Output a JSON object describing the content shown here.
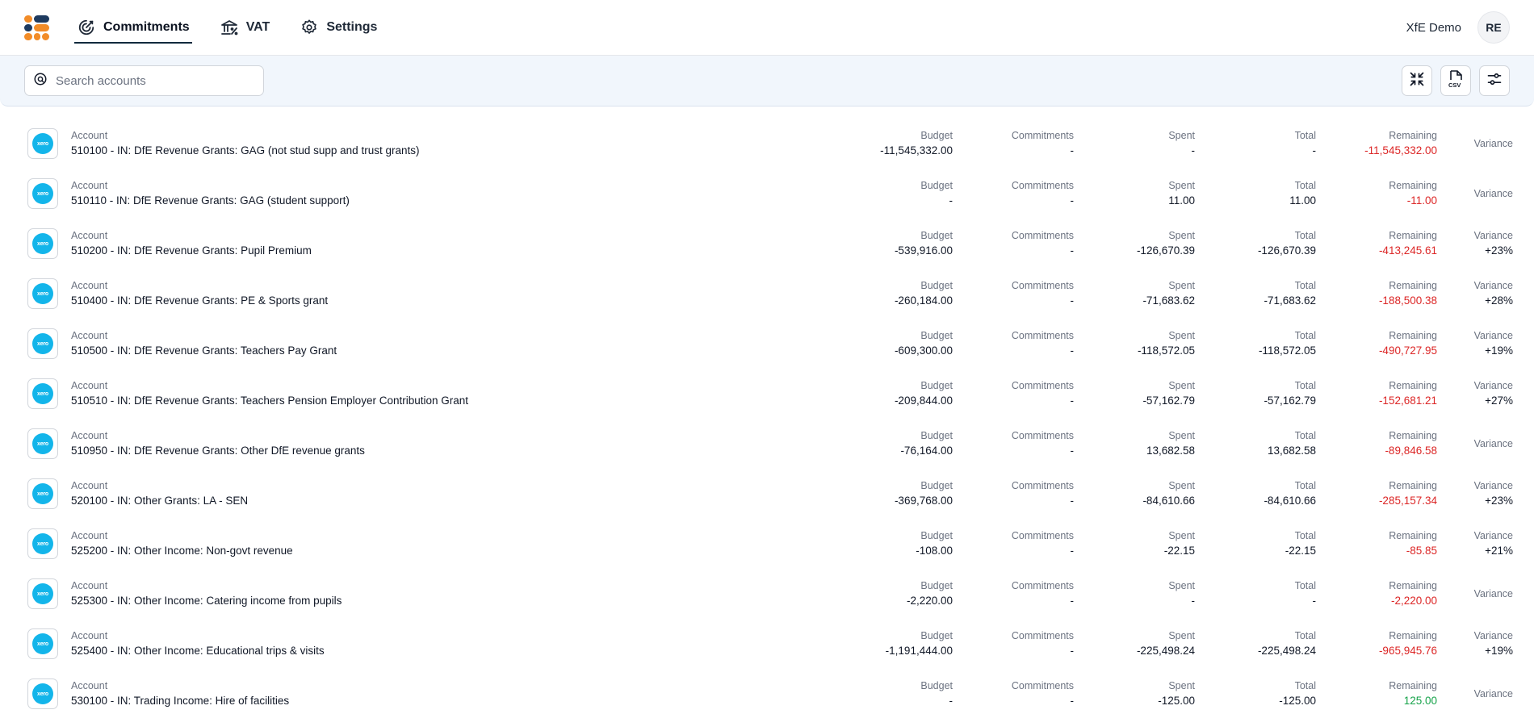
{
  "nav": {
    "items": [
      {
        "label": "Commitments",
        "icon": "target-icon",
        "active": true
      },
      {
        "label": "VAT",
        "icon": "bank-percent-icon",
        "active": false
      },
      {
        "label": "Settings",
        "icon": "gear-icon",
        "active": false
      }
    ],
    "org_name": "XfE Demo",
    "avatar_initials": "RE"
  },
  "toolbar": {
    "search_placeholder": "Search accounts",
    "buttons": [
      "collapse-icon",
      "csv-export-icon",
      "filter-settings-icon"
    ]
  },
  "labels": {
    "account": "Account",
    "budget": "Budget",
    "commitments": "Commitments",
    "spent": "Spent",
    "total": "Total",
    "remaining": "Remaining",
    "variance": "Variance"
  },
  "accounts": [
    {
      "name": "510100 - IN: DfE Revenue Grants: GAG (not stud supp and trust grants)",
      "budget": "-11,545,332.00",
      "commitments": "-",
      "spent": "-",
      "total": "-",
      "remaining": "-11,545,332.00",
      "remaining_status": "neg",
      "variance": ""
    },
    {
      "name": "510110 - IN: DfE Revenue Grants: GAG (student support)",
      "budget": "-",
      "commitments": "-",
      "spent": "11.00",
      "total": "11.00",
      "remaining": "-11.00",
      "remaining_status": "neg",
      "variance": ""
    },
    {
      "name": "510200 - IN: DfE Revenue Grants: Pupil Premium",
      "budget": "-539,916.00",
      "commitments": "-",
      "spent": "-126,670.39",
      "total": "-126,670.39",
      "remaining": "-413,245.61",
      "remaining_status": "neg",
      "variance": "+23%"
    },
    {
      "name": "510400 - IN: DfE Revenue Grants: PE & Sports grant",
      "budget": "-260,184.00",
      "commitments": "-",
      "spent": "-71,683.62",
      "total": "-71,683.62",
      "remaining": "-188,500.38",
      "remaining_status": "neg",
      "variance": "+28%"
    },
    {
      "name": "510500 - IN: DfE Revenue Grants: Teachers Pay Grant",
      "budget": "-609,300.00",
      "commitments": "-",
      "spent": "-118,572.05",
      "total": "-118,572.05",
      "remaining": "-490,727.95",
      "remaining_status": "neg",
      "variance": "+19%"
    },
    {
      "name": "510510 - IN: DfE Revenue Grants: Teachers Pension Employer Contribution Grant",
      "budget": "-209,844.00",
      "commitments": "-",
      "spent": "-57,162.79",
      "total": "-57,162.79",
      "remaining": "-152,681.21",
      "remaining_status": "neg",
      "variance": "+27%"
    },
    {
      "name": "510950 - IN: DfE Revenue Grants: Other DfE revenue grants",
      "budget": "-76,164.00",
      "commitments": "-",
      "spent": "13,682.58",
      "total": "13,682.58",
      "remaining": "-89,846.58",
      "remaining_status": "neg",
      "variance": ""
    },
    {
      "name": "520100 - IN: Other Grants: LA - SEN",
      "budget": "-369,768.00",
      "commitments": "-",
      "spent": "-84,610.66",
      "total": "-84,610.66",
      "remaining": "-285,157.34",
      "remaining_status": "neg",
      "variance": "+23%"
    },
    {
      "name": "525200 - IN: Other Income: Non-govt revenue",
      "budget": "-108.00",
      "commitments": "-",
      "spent": "-22.15",
      "total": "-22.15",
      "remaining": "-85.85",
      "remaining_status": "neg",
      "variance": "+21%"
    },
    {
      "name": "525300 - IN: Other Income: Catering income from pupils",
      "budget": "-2,220.00",
      "commitments": "-",
      "spent": "-",
      "total": "-",
      "remaining": "-2,220.00",
      "remaining_status": "neg",
      "variance": ""
    },
    {
      "name": "525400 - IN: Other Income: Educational trips & visits",
      "budget": "-1,191,444.00",
      "commitments": "-",
      "spent": "-225,498.24",
      "total": "-225,498.24",
      "remaining": "-965,945.76",
      "remaining_status": "neg",
      "variance": "+19%"
    },
    {
      "name": "530100 - IN: Trading Income: Hire of facilities",
      "budget": "-",
      "commitments": "-",
      "spent": "-125.00",
      "total": "-125.00",
      "remaining": "125.00",
      "remaining_status": "pos",
      "variance": ""
    }
  ],
  "colors": {
    "brand_orange": "#f28c28",
    "brand_navy": "#1e3a5f",
    "xero_blue": "#13b5ea",
    "negative": "#dc2626",
    "positive": "#16a34a"
  }
}
